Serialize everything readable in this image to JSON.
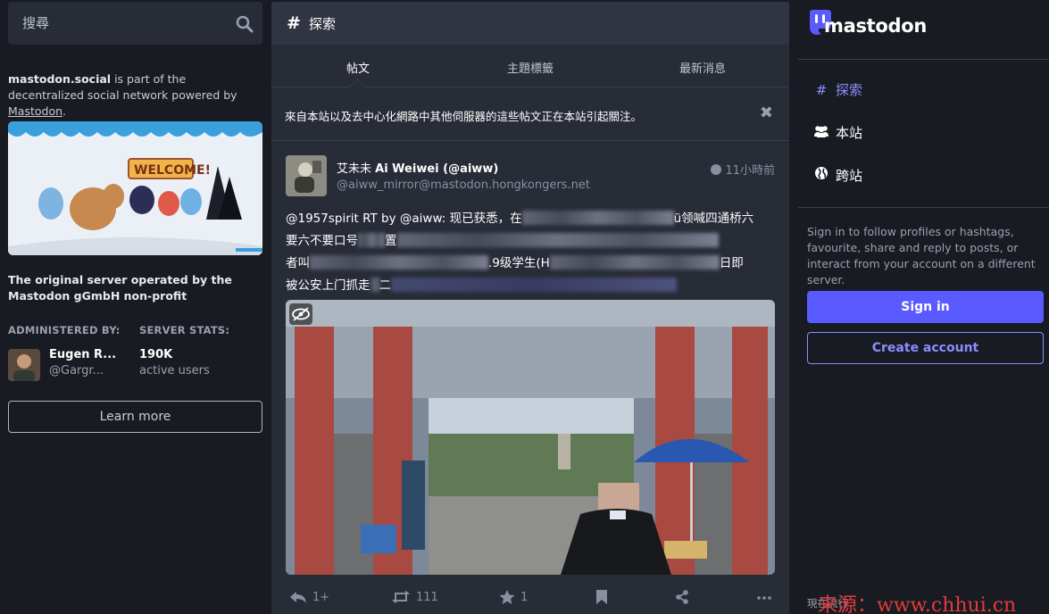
{
  "search": {
    "placeholder": "搜尋"
  },
  "about": {
    "server": "mastodon.social",
    "text_mid": " is part of the decentralized social network powered by ",
    "link": "Mastodon",
    "text_end": "."
  },
  "server_desc": "The original server operated by the Mastodon gGmbH non-profit",
  "admin": {
    "label": "ADMINISTERED BY:",
    "name": "Eugen R...",
    "handle": "@Gargr..."
  },
  "stats": {
    "label": "SERVER STATS:",
    "number": "190K",
    "caption": "active users"
  },
  "learn_more": "Learn more",
  "explore": {
    "icon": "#",
    "title": "探索",
    "tabs": [
      "帖文",
      "主題標籤",
      "最新消息"
    ],
    "active_tab": 0,
    "banner": "來自本站以及去中心化網路中其他伺服器的這些帖文正在本站引起關注。",
    "close_icon": "✖"
  },
  "post": {
    "display_name_prefix": "艾未未 ",
    "display_name": "Ai Weiwei (@aiww)",
    "handle": "@aiww_mirror@mastodon.hongkongers.net",
    "time": "11小時前",
    "line1_a": "@1957spirit RT by @aiww: 现已获悉，在",
    "line1_b": "ü领喊四通桥六",
    "line2_a": "要六不要口号",
    "line2_b": "置",
    "line3_a": "者叫",
    "line3_b": ".9级学生(H",
    "line3_c": "日即",
    "line4_a": "被公安上门抓走",
    "line4_b": "二",
    "actions": {
      "reply_count": "1+",
      "boost_count": "111",
      "fav_count": "1"
    }
  },
  "right": {
    "brand": "mastodon",
    "nav": [
      {
        "icon": "hash-icon",
        "label": "探索"
      },
      {
        "icon": "users-icon",
        "label": "本站"
      },
      {
        "icon": "globe-icon",
        "label": "跨站"
      }
    ],
    "signin_text": "Sign in to follow profiles or hashtags, favourite, share and reply to posts, or interact from your account on a different server.",
    "signin_btn": "Sign in",
    "create_btn": "Create account",
    "trending": "現在流行"
  },
  "watermark": "来源：www.chhui.cn",
  "colors": {
    "accent": "#595aff",
    "accent_light": "#8c8dff",
    "bg": "#191b22",
    "panel": "#282c37"
  }
}
